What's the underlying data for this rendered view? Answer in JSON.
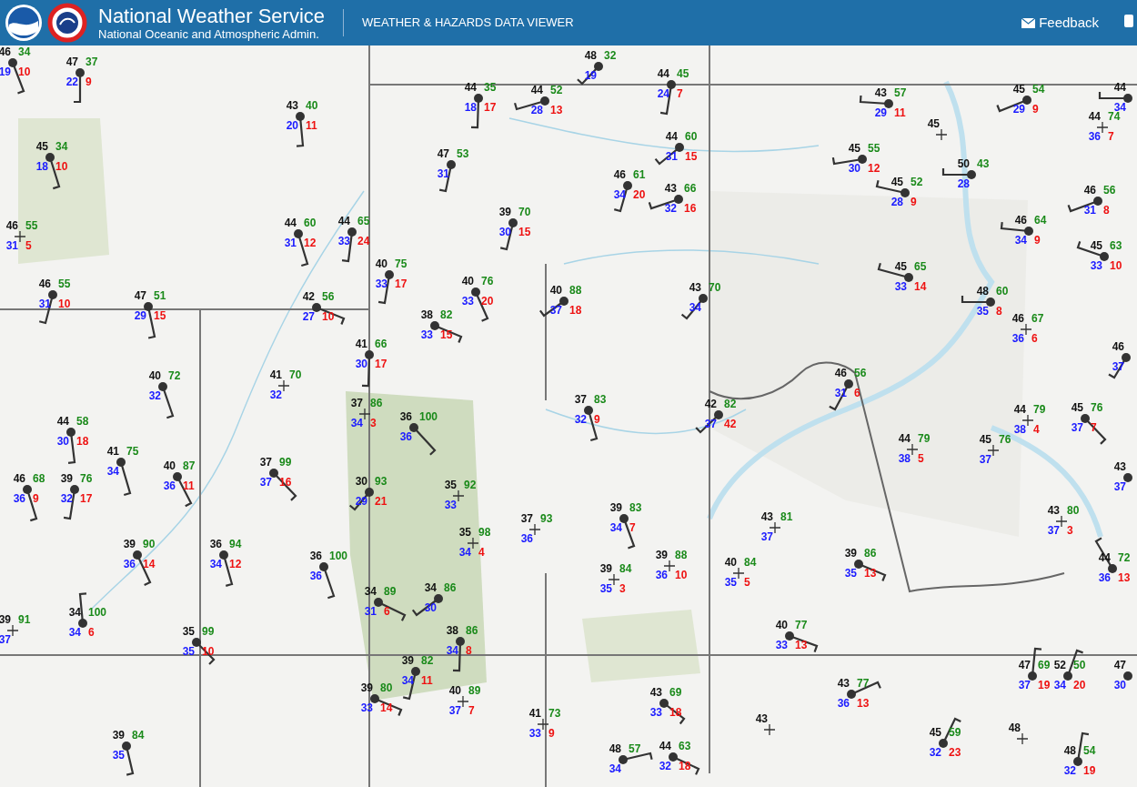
{
  "header": {
    "title": "National Weather Service",
    "subtitle": "National Oceanic and Atmospheric Admin.",
    "app_name": "WEATHER & HAZARDS DATA VIEWER",
    "feedback": "Feedback"
  },
  "stations": [
    {
      "kind": "wind",
      "temperature": "46",
      "humidity": "34",
      "dewpoint": "19",
      "wind_speed": "10"
    },
    {
      "kind": "wind",
      "temperature": "48",
      "humidity": "32",
      "dewpoint": "19"
    },
    {
      "kind": "wind",
      "temperature": "47",
      "humidity": "37",
      "dewpoint": "22",
      "wind_speed": "9"
    },
    {
      "kind": "wind",
      "temperature": "44",
      "humidity": "45",
      "dewpoint": "24",
      "wind_speed": "7"
    },
    {
      "kind": "wind",
      "temperature": "44",
      "humidity": "35",
      "dewpoint": "18",
      "wind_speed": "17"
    },
    {
      "kind": "wind",
      "temperature": "44",
      "humidity": "52",
      "dewpoint": "28",
      "wind_speed": "13"
    },
    {
      "kind": "wind",
      "temperature": "43",
      "humidity": "57",
      "dewpoint": "29",
      "wind_speed": "11"
    },
    {
      "kind": "wind",
      "temperature": "45",
      "humidity": "54",
      "dewpoint": "29",
      "wind_speed": "9"
    },
    {
      "kind": "wind",
      "temperature": "44",
      "dewpoint": "34"
    },
    {
      "kind": "wind",
      "temperature": "43",
      "humidity": "40",
      "dewpoint": "20",
      "wind_speed": "11"
    },
    {
      "kind": "calm",
      "temperature": "45"
    },
    {
      "kind": "calm",
      "temperature": "44",
      "humidity": "74",
      "dewpoint": "36",
      "wind_speed": "7"
    },
    {
      "kind": "wind",
      "temperature": "44",
      "humidity": "60",
      "dewpoint": "31",
      "wind_speed": "15"
    },
    {
      "kind": "wind",
      "temperature": "45",
      "humidity": "34",
      "dewpoint": "18",
      "wind_speed": "10"
    },
    {
      "kind": "wind",
      "temperature": "47",
      "humidity": "53",
      "dewpoint": "31"
    },
    {
      "kind": "wind",
      "temperature": "45",
      "humidity": "55",
      "dewpoint": "30",
      "wind_speed": "12"
    },
    {
      "kind": "wind",
      "temperature": "50",
      "humidity": "43",
      "dewpoint": "28"
    },
    {
      "kind": "wind",
      "temperature": "46",
      "humidity": "61",
      "dewpoint": "34",
      "wind_speed": "20"
    },
    {
      "kind": "wind",
      "temperature": "45",
      "humidity": "52",
      "dewpoint": "28",
      "wind_speed": "9"
    },
    {
      "kind": "wind",
      "temperature": "43",
      "humidity": "66",
      "dewpoint": "32",
      "wind_speed": "16"
    },
    {
      "kind": "wind",
      "temperature": "46",
      "humidity": "56",
      "dewpoint": "31",
      "wind_speed": "8"
    },
    {
      "kind": "wind",
      "temperature": "39",
      "humidity": "70",
      "dewpoint": "30",
      "wind_speed": "15"
    },
    {
      "kind": "calm",
      "temperature": "46",
      "humidity": "55",
      "dewpoint": "31",
      "wind_speed": "5"
    },
    {
      "kind": "wind",
      "temperature": "44",
      "humidity": "60",
      "dewpoint": "31",
      "wind_speed": "12"
    },
    {
      "kind": "wind",
      "temperature": "44",
      "humidity": "65",
      "dewpoint": "33",
      "wind_speed": "24"
    },
    {
      "kind": "wind",
      "temperature": "46",
      "humidity": "64",
      "dewpoint": "34",
      "wind_speed": "9"
    },
    {
      "kind": "wind",
      "temperature": "45",
      "humidity": "63",
      "dewpoint": "33",
      "wind_speed": "10"
    },
    {
      "kind": "wind",
      "temperature": "40",
      "humidity": "75",
      "dewpoint": "33",
      "wind_speed": "17"
    },
    {
      "kind": "wind",
      "temperature": "45",
      "humidity": "65",
      "dewpoint": "33",
      "wind_speed": "14"
    },
    {
      "kind": "wind",
      "temperature": "46",
      "humidity": "55",
      "dewpoint": "31",
      "wind_speed": "10"
    },
    {
      "kind": "wind",
      "temperature": "47",
      "humidity": "51",
      "dewpoint": "29",
      "wind_speed": "15"
    },
    {
      "kind": "wind",
      "temperature": "42",
      "humidity": "56",
      "dewpoint": "27",
      "wind_speed": "10"
    },
    {
      "kind": "wind",
      "temperature": "40",
      "humidity": "76",
      "dewpoint": "33",
      "wind_speed": "20"
    },
    {
      "kind": "wind",
      "temperature": "40",
      "humidity": "88",
      "dewpoint": "37",
      "wind_speed": "18"
    },
    {
      "kind": "wind",
      "temperature": "43",
      "humidity": "70",
      "dewpoint": "34"
    },
    {
      "kind": "wind",
      "temperature": "48",
      "humidity": "60",
      "dewpoint": "35",
      "wind_speed": "8"
    },
    {
      "kind": "wind",
      "temperature": "38",
      "humidity": "82",
      "dewpoint": "33",
      "wind_speed": "15"
    },
    {
      "kind": "calm",
      "temperature": "46",
      "humidity": "67",
      "dewpoint": "36",
      "wind_speed": "6"
    },
    {
      "kind": "wind",
      "temperature": "41",
      "humidity": "66",
      "dewpoint": "30",
      "wind_speed": "17"
    },
    {
      "kind": "wind",
      "temperature": "46",
      "dewpoint": "37"
    },
    {
      "kind": "wind",
      "temperature": "40",
      "humidity": "72",
      "dewpoint": "32"
    },
    {
      "kind": "calm",
      "temperature": "41",
      "humidity": "70",
      "dewpoint": "32"
    },
    {
      "kind": "wind",
      "temperature": "46",
      "humidity": "56",
      "dewpoint": "31",
      "wind_speed": "6"
    },
    {
      "kind": "calm",
      "temperature": "37",
      "humidity": "86",
      "dewpoint": "34",
      "wind_speed": "3"
    },
    {
      "kind": "wind",
      "temperature": "37",
      "humidity": "83",
      "dewpoint": "32",
      "wind_speed": "9"
    },
    {
      "kind": "wind",
      "temperature": "42",
      "humidity": "82",
      "dewpoint": "37",
      "wind_speed": "42"
    },
    {
      "kind": "calm",
      "temperature": "44",
      "humidity": "79",
      "dewpoint": "38",
      "wind_speed": "4"
    },
    {
      "kind": "wind",
      "temperature": "45",
      "humidity": "76",
      "dewpoint": "37",
      "wind_speed": "7"
    },
    {
      "kind": "wind",
      "temperature": "44",
      "humidity": "58",
      "dewpoint": "30",
      "wind_speed": "18"
    },
    {
      "kind": "wind",
      "temperature": "36",
      "humidity": "100",
      "dewpoint": "36"
    },
    {
      "kind": "calm",
      "temperature": "44",
      "humidity": "79",
      "dewpoint": "38",
      "wind_speed": "5"
    },
    {
      "kind": "calm",
      "temperature": "45",
      "humidity": "76",
      "dewpoint": "37"
    },
    {
      "kind": "wind",
      "temperature": "41",
      "humidity": "75",
      "dewpoint": "34"
    },
    {
      "kind": "wind",
      "temperature": "40",
      "humidity": "87",
      "dewpoint": "36",
      "wind_speed": "11"
    },
    {
      "kind": "wind",
      "temperature": "37",
      "humidity": "99",
      "dewpoint": "37",
      "wind_speed": "16"
    },
    {
      "kind": "wind",
      "temperature": "43",
      "dewpoint": "37"
    },
    {
      "kind": "wind",
      "temperature": "46",
      "humidity": "68",
      "dewpoint": "36",
      "wind_speed": "9"
    },
    {
      "kind": "wind",
      "temperature": "39",
      "humidity": "76",
      "dewpoint": "32",
      "wind_speed": "17"
    },
    {
      "kind": "wind",
      "temperature": "30",
      "humidity": "93",
      "dewpoint": "29",
      "wind_speed": "21"
    },
    {
      "kind": "calm",
      "temperature": "35",
      "humidity": "92",
      "dewpoint": "33"
    },
    {
      "kind": "wind",
      "temperature": "39",
      "humidity": "83",
      "dewpoint": "34",
      "wind_speed": "7"
    },
    {
      "kind": "calm",
      "temperature": "43",
      "humidity": "80",
      "dewpoint": "37",
      "wind_speed": "3"
    },
    {
      "kind": "calm",
      "temperature": "37",
      "humidity": "93",
      "dewpoint": "36"
    },
    {
      "kind": "calm",
      "temperature": "43",
      "humidity": "81",
      "dewpoint": "37"
    },
    {
      "kind": "calm",
      "temperature": "35",
      "humidity": "98",
      "dewpoint": "34",
      "wind_speed": "4"
    },
    {
      "kind": "wind",
      "temperature": "39",
      "humidity": "90",
      "dewpoint": "36",
      "wind_speed": "14"
    },
    {
      "kind": "wind",
      "temperature": "36",
      "humidity": "94",
      "dewpoint": "34",
      "wind_speed": "12"
    },
    {
      "kind": "wind",
      "temperature": "36",
      "humidity": "100",
      "dewpoint": "36"
    },
    {
      "kind": "calm",
      "temperature": "39",
      "humidity": "84",
      "dewpoint": "35",
      "wind_speed": "3"
    },
    {
      "kind": "calm",
      "temperature": "39",
      "humidity": "88",
      "dewpoint": "36",
      "wind_speed": "10"
    },
    {
      "kind": "calm",
      "temperature": "40",
      "humidity": "84",
      "dewpoint": "35",
      "wind_speed": "5"
    },
    {
      "kind": "wind",
      "temperature": "39",
      "humidity": "86",
      "dewpoint": "35",
      "wind_speed": "13"
    },
    {
      "kind": "wind",
      "temperature": "44",
      "humidity": "72",
      "dewpoint": "36",
      "wind_speed": "13"
    },
    {
      "kind": "wind",
      "temperature": "34",
      "humidity": "89",
      "dewpoint": "31",
      "wind_speed": "6"
    },
    {
      "kind": "wind",
      "temperature": "34",
      "humidity": "86",
      "dewpoint": "30"
    },
    {
      "kind": "calm",
      "temperature": "39",
      "humidity": "91",
      "dewpoint": "37"
    },
    {
      "kind": "wind",
      "temperature": "34",
      "humidity": "100",
      "dewpoint": "34",
      "wind_speed": "6"
    },
    {
      "kind": "wind",
      "temperature": "40",
      "humidity": "77",
      "dewpoint": "33",
      "wind_speed": "13"
    },
    {
      "kind": "wind",
      "temperature": "35",
      "humidity": "99",
      "dewpoint": "35",
      "wind_speed": "10"
    },
    {
      "kind": "wind",
      "temperature": "38",
      "humidity": "86",
      "dewpoint": "34",
      "wind_speed": "8"
    },
    {
      "kind": "wind",
      "temperature": "39",
      "humidity": "82",
      "dewpoint": "34",
      "wind_speed": "11"
    },
    {
      "kind": "wind",
      "temperature": "47",
      "humidity": "69",
      "dewpoint": "37",
      "wind_speed": "19"
    },
    {
      "kind": "wind",
      "temperature": "52",
      "humidity": "50",
      "dewpoint": "34",
      "wind_speed": "20"
    },
    {
      "kind": "wind",
      "temperature": "47",
      "dewpoint": "30"
    },
    {
      "kind": "wind",
      "temperature": "39",
      "humidity": "80",
      "dewpoint": "33",
      "wind_speed": "14"
    },
    {
      "kind": "calm",
      "temperature": "40",
      "humidity": "89",
      "dewpoint": "37",
      "wind_speed": "7"
    },
    {
      "kind": "wind",
      "temperature": "43",
      "humidity": "69",
      "dewpoint": "33",
      "wind_speed": "18"
    },
    {
      "kind": "wind",
      "temperature": "43",
      "humidity": "77",
      "dewpoint": "36",
      "wind_speed": "13"
    },
    {
      "kind": "calm",
      "temperature": "41",
      "humidity": "73",
      "dewpoint": "33",
      "wind_speed": "9"
    },
    {
      "kind": "calm",
      "temperature": "43"
    },
    {
      "kind": "wind",
      "temperature": "39",
      "humidity": "84",
      "dewpoint": "35"
    },
    {
      "kind": "wind",
      "temperature": "45",
      "humidity": "59",
      "dewpoint": "32",
      "wind_speed": "23"
    },
    {
      "kind": "calm",
      "temperature": "48"
    },
    {
      "kind": "wind",
      "temperature": "48",
      "humidity": "57",
      "dewpoint": "34"
    },
    {
      "kind": "wind",
      "temperature": "44",
      "humidity": "63",
      "dewpoint": "32",
      "wind_speed": "18"
    },
    {
      "kind": "wind",
      "temperature": "48",
      "humidity": "54",
      "dewpoint": "32",
      "wind_speed": "19"
    }
  ]
}
